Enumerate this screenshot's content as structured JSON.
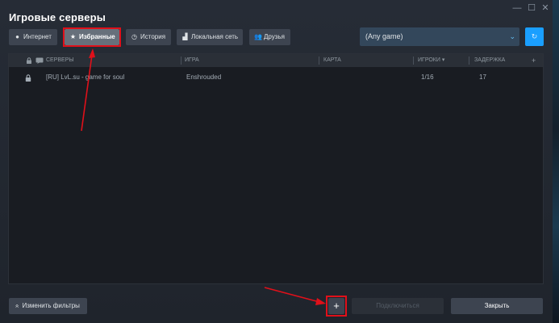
{
  "window": {
    "title": "Игровые серверы",
    "controls": {
      "minimize": "—",
      "maximize": "☐",
      "close": "✕"
    }
  },
  "tabs": [
    {
      "label": "Интернет",
      "icon": "globe-icon",
      "glyph": "●",
      "active": false
    },
    {
      "label": "Избранные",
      "icon": "star-icon",
      "glyph": "★",
      "active": true
    },
    {
      "label": "История",
      "icon": "clock-icon",
      "glyph": "◷",
      "active": false
    },
    {
      "label": "Локальная сеть",
      "icon": "lan-icon",
      "glyph": "▟",
      "active": false
    },
    {
      "label": "Друзья",
      "icon": "friends-icon",
      "glyph": "👥",
      "active": false
    }
  ],
  "game_filter": {
    "selected": "(Any game)",
    "chevron": "⌄"
  },
  "refresh_glyph": "↻",
  "table": {
    "columns": {
      "servers": "СЕРВЕРЫ",
      "game": "ИГРА",
      "map": "КАРТА",
      "players": "ИГРОКИ",
      "players_sort": "▾",
      "latency": "ЗАДЕРЖКА",
      "add": "+"
    },
    "rows": [
      {
        "locked": true,
        "name": "[RU] LvL.su - game for soul",
        "game": "Enshrouded",
        "map": "",
        "players": "1/16",
        "latency": "17"
      }
    ]
  },
  "footer": {
    "filters_icon": "«",
    "filters_label": "Изменить фильтры",
    "add_label": "+",
    "connect_label": "Подключиться",
    "close_label": "Закрыть"
  },
  "colors": {
    "highlight": "#e0101a",
    "accent": "#1a9fff"
  }
}
